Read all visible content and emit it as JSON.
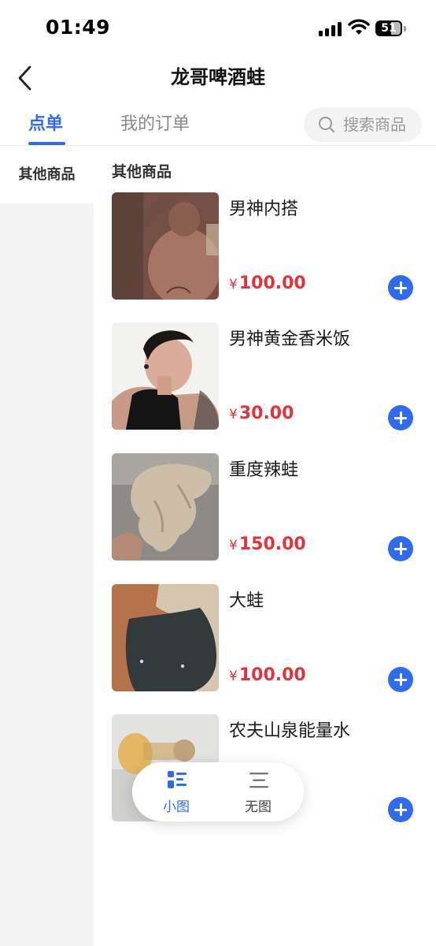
{
  "status": {
    "time": "01:49",
    "battery": "51"
  },
  "nav": {
    "title": "龙哥啤酒蛙"
  },
  "tabs": [
    {
      "label": "点单",
      "active": true
    },
    {
      "label": "我的订单",
      "active": false
    }
  ],
  "search": {
    "placeholder": "搜索商品"
  },
  "sidebar": {
    "items": [
      {
        "label": "其他商品",
        "active": true
      }
    ]
  },
  "category": {
    "title": "其他商品"
  },
  "products": [
    {
      "name": "男神内搭",
      "price_symbol": "¥",
      "price": "100.00"
    },
    {
      "name": "男神黄金香米饭",
      "price_symbol": "¥",
      "price": "30.00"
    },
    {
      "name": "重度辣蛙",
      "price_symbol": "¥",
      "price": "150.00"
    },
    {
      "name": "大蛙",
      "price_symbol": "¥",
      "price": "100.00"
    },
    {
      "name": "农夫山泉能量水",
      "price_symbol": "¥",
      "price": ""
    }
  ],
  "view_toggle": {
    "small_label": "小图",
    "none_label": "无图",
    "active": "small"
  },
  "colors": {
    "accent": "#2f6bf0",
    "price": "#e2333b",
    "sidebar_bg": "#f4f4f4"
  },
  "icons": {
    "back": "chevron-left-icon",
    "search": "search-icon",
    "add": "plus-circle-icon"
  }
}
